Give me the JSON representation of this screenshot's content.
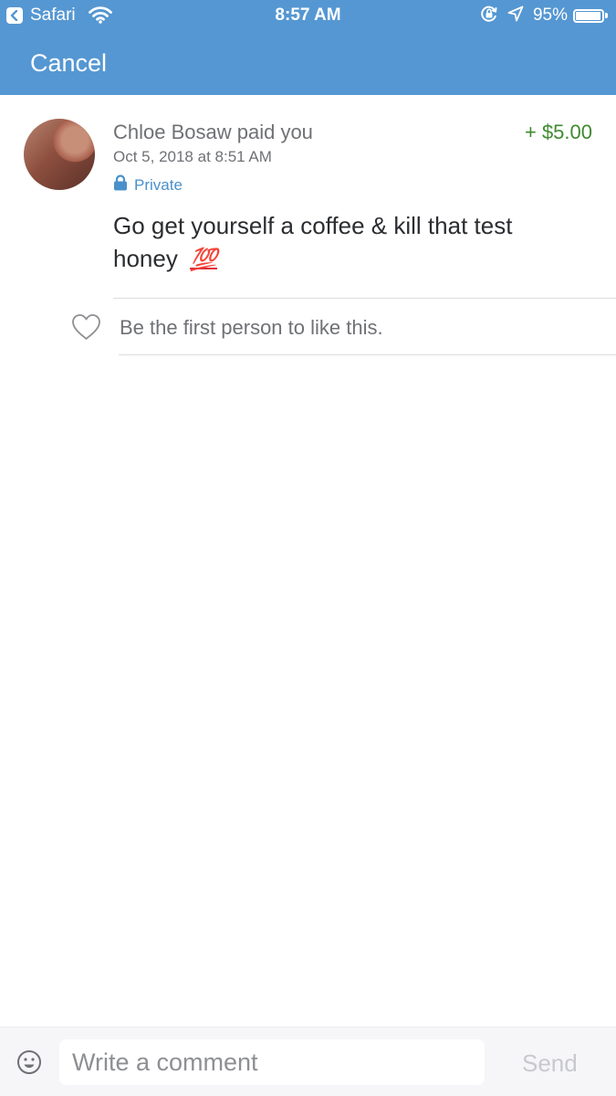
{
  "status_bar": {
    "back_app_label": "Safari",
    "time": "8:57 AM",
    "battery_percent_label": "95%",
    "battery_level": 0.95,
    "icons": [
      "back-chevron-icon",
      "wifi-icon",
      "rotation-lock-icon",
      "location-arrow-icon",
      "battery-icon"
    ]
  },
  "nav": {
    "cancel_label": "Cancel",
    "background_color": "#5597d2"
  },
  "story": {
    "avatar_icon": "user-avatar",
    "headline": "Chloe Bosaw paid you",
    "amount": "+ $5.00",
    "amount_color": "#3d8b2f",
    "date": "Oct 5, 2018 at 8:51 AM",
    "privacy_icon": "lock-icon",
    "privacy_label": "Private",
    "note": "Go get yourself a coffee & kill that test honey",
    "note_emoji": "💯"
  },
  "likes": {
    "heart_icon": "heart-outline-icon",
    "text": "Be the first person to like this."
  },
  "comment_bar": {
    "emoji_icon": "smiley-icon",
    "placeholder": "Write a comment",
    "value": "",
    "send_label": "Send"
  }
}
